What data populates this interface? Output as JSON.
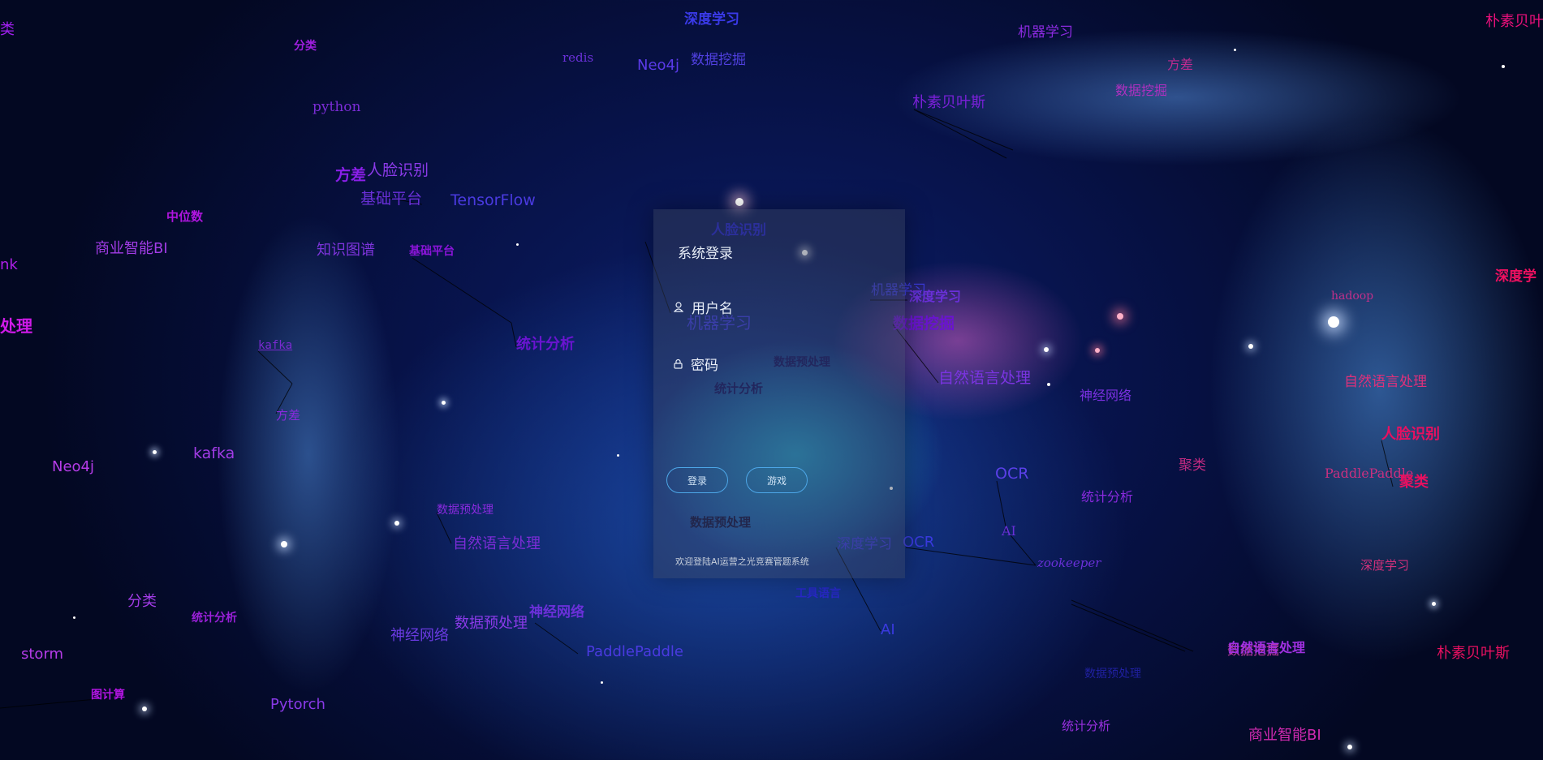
{
  "login": {
    "title": "系统登录",
    "username_label": "用户名",
    "password_label": "密码",
    "login_button": "登录",
    "game_button": "游戏",
    "welcome": "欢迎登陆AI运营之光竞赛管题系统"
  },
  "colors": {
    "button_border": "#4da7e8",
    "panel": "rgba(60,70,90,0.42)"
  },
  "cloud_words": [
    "类",
    "分类",
    "python",
    "方差",
    "人脸识别",
    "基础平台",
    "TensorFlow",
    "中位数",
    "商业智能BI",
    "知识图谱",
    "基础平台",
    "nk",
    "处理",
    "统计分析",
    "kafka",
    "方差",
    "Neo4j",
    "kafka",
    "自然语言处理",
    "数据预处理",
    "分类",
    "统计分析",
    "storm",
    "神经网络",
    "数据预处理",
    "神经网络",
    "PaddlePaddle",
    "图计算",
    "Pytorch",
    "深度学习",
    "redis",
    "Neo4j",
    "数据挖掘",
    "人脸识别",
    "机器学习",
    "数据预处理",
    "统计分析",
    "数据预处理",
    "深度学习",
    "工具语言",
    "AI",
    "机器学习",
    "深度学习",
    "数据挖掘",
    "自然语言处理",
    "OCR",
    "OCR",
    "AI",
    "zookeeper",
    "统计分析",
    "朴素贝叶斯",
    "数据挖掘",
    "方差",
    "机器学习",
    "朴素贝叶斯",
    "hadoop",
    "自然语言处理",
    "人脸识别",
    "PaddlePaddle",
    "聚类",
    "深度学习",
    "数据挖掘",
    "统计分析",
    "朴素贝叶斯",
    "商业智能BI",
    "数据预处理",
    "神经网络",
    "自然语言处理",
    "聚类",
    "深度学"
  ]
}
